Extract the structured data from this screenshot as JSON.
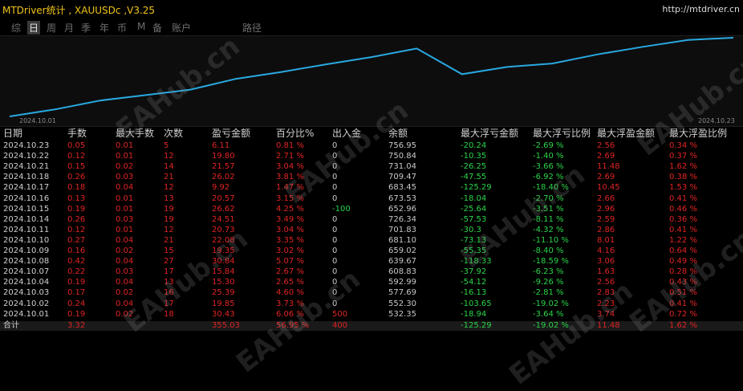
{
  "header": {
    "title": "MTDriver统计 , XAUUSDc ,V3.25",
    "url": "http://mtdriver.cn"
  },
  "tabs": [
    "综",
    "日",
    "周",
    "月",
    "季",
    "年",
    "币",
    "M",
    "备",
    "账户",
    "路径"
  ],
  "active_tab": 1,
  "chart": {
    "start_label": "2024.10.01",
    "end_label": "2024.10.23",
    "line_color": "#29a8e0"
  },
  "table": {
    "columns": [
      "日期",
      "手数",
      "最大手数",
      "次数",
      "盈亏金额",
      "百分比%",
      "出入金",
      "余额",
      "最大浮亏金额",
      "最大浮亏比例",
      "最大浮盈金额",
      "最大浮盈比例"
    ],
    "rows": [
      [
        "2024.10.23",
        "0.05",
        "0.01",
        "5",
        "6.11",
        "0.81 %",
        "0",
        "756.95",
        "-20.24",
        "-2.69 %",
        "2.56",
        "0.34 %"
      ],
      [
        "2024.10.22",
        "0.12",
        "0.01",
        "12",
        "19.80",
        "2.71 %",
        "0",
        "750.84",
        "-10.35",
        "-1.40 %",
        "2.69",
        "0.37 %"
      ],
      [
        "2024.10.21",
        "0.15",
        "0.02",
        "14",
        "21.57",
        "3.04 %",
        "0",
        "731.04",
        "-26.25",
        "-3.66 %",
        "11.48",
        "1.62 %"
      ],
      [
        "2024.10.18",
        "0.26",
        "0.03",
        "21",
        "26.02",
        "3.81 %",
        "0",
        "709.47",
        "-47.55",
        "-6.92 %",
        "2.69",
        "0.38 %"
      ],
      [
        "2024.10.17",
        "0.18",
        "0.04",
        "12",
        "9.92",
        "1.47 %",
        "0",
        "683.45",
        "-125.29",
        "-18.40 %",
        "10.45",
        "1.53 %"
      ],
      [
        "2024.10.16",
        "0.13",
        "0.01",
        "13",
        "20.57",
        "3.15 %",
        "0",
        "673.53",
        "-18.04",
        "-2.70 %",
        "2.66",
        "0.41 %"
      ],
      [
        "2024.10.15",
        "0.19",
        "0.01",
        "19",
        "26.62",
        "4.25 %",
        "-100",
        "652.96",
        "-25.64",
        "-3.51 %",
        "2.96",
        "0.46 %"
      ],
      [
        "2024.10.14",
        "0.26",
        "0.03",
        "19",
        "24.51",
        "3.49 %",
        "0",
        "726.34",
        "-57.53",
        "-8.11 %",
        "2.59",
        "0.36 %"
      ],
      [
        "2024.10.11",
        "0.12",
        "0.01",
        "12",
        "20.73",
        "3.04 %",
        "0",
        "701.83",
        "-30.3",
        "-4.32 %",
        "2.86",
        "0.41 %"
      ],
      [
        "2024.10.10",
        "0.27",
        "0.04",
        "21",
        "22.08",
        "3.35 %",
        "0",
        "681.10",
        "-73.13",
        "-11.10 %",
        "8.01",
        "1.22 %"
      ],
      [
        "2024.10.09",
        "0.16",
        "0.02",
        "15",
        "19.35",
        "3.02 %",
        "0",
        "659.02",
        "-55.35",
        "-8.40 %",
        "4.16",
        "0.64 %"
      ],
      [
        "2024.10.08",
        "0.42",
        "0.04",
        "27",
        "30.84",
        "5.07 %",
        "0",
        "639.67",
        "-118.33",
        "-18.59 %",
        "3.06",
        "0.49 %"
      ],
      [
        "2024.10.07",
        "0.22",
        "0.03",
        "17",
        "15.84",
        "2.67 %",
        "0",
        "608.83",
        "-37.92",
        "-6.23 %",
        "1.63",
        "0.28 %"
      ],
      [
        "2024.10.04",
        "0.19",
        "0.04",
        "13",
        "15.30",
        "2.65 %",
        "0",
        "592.99",
        "-54.12",
        "-9.26 %",
        "2.56",
        "0.43 %"
      ],
      [
        "2024.10.03",
        "0.17",
        "0.02",
        "16",
        "25.39",
        "4.60 %",
        "0",
        "577.69",
        "-16.13",
        "-2.81 %",
        "2.83",
        "0.51 %"
      ],
      [
        "2024.10.02",
        "0.24",
        "0.04",
        "17",
        "19.85",
        "3.73 %",
        "0",
        "552.30",
        "-103.65",
        "-19.02 %",
        "2.23",
        "0.41 %"
      ],
      [
        "2024.10.01",
        "0.19",
        "0.02",
        "18",
        "30.43",
        "6.06 %",
        "500",
        "532.35",
        "-18.94",
        "-3.64 %",
        "3.74",
        "0.72 %"
      ]
    ],
    "total": [
      "合计",
      "3.32",
      "",
      "",
      "355.03",
      "56.95 %",
      "400",
      "",
      "-125.29",
      "-19.02 %",
      "11.48",
      "1.62 %"
    ]
  },
  "watermark": "EAHub.cn"
}
